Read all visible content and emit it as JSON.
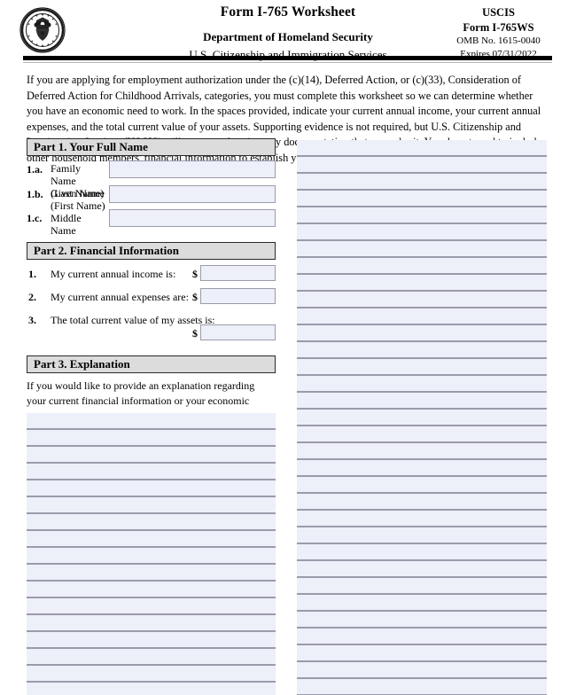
{
  "document": {
    "header": {
      "seal_icon": "dhs-seal-icon",
      "title": "Form I-765 Worksheet",
      "department": "Department of Homeland Security",
      "agency": "U.S. Citizenship and Immigration Services",
      "agency_short": "USCIS",
      "form_number": "Form I-765WS",
      "omb_number": "OMB No. 1615-0040",
      "expires": "Expires 07/31/2022"
    },
    "intro": "If you are applying for employment authorization under the (c)(14), Deferred Action, or (c)(33), Consideration of Deferred Action for Childhood Arrivals, categories, you must complete this worksheet so we can determine whether you have an economic need to work. In the spaces provided, indicate your current annual income, your current annual expenses, and the total current value of your assets. Supporting evidence is not required, but U.S. Citizenship and Immigration Services (USCIS) will accept and review any documentation that you submit.  You do not need to include other household members' financial information to establish your own economic necessity.",
    "part1": {
      "heading": "Part 1.  Your Full Name",
      "items": [
        {
          "number": "1.a.",
          "label_line1": "Family Name",
          "label_line2": "(Last Name)",
          "value": ""
        },
        {
          "number": "1.b.",
          "label_line1": "Given Name",
          "label_line2": "(First Name)",
          "value": ""
        },
        {
          "number": "1.c.",
          "label_line1": "Middle Name",
          "label_line2": "",
          "value": ""
        }
      ]
    },
    "part2": {
      "heading": "Part 2.  Financial Information",
      "currency_symbol": "$",
      "items": [
        {
          "number": "1.",
          "label": "My current annual income is:",
          "value": ""
        },
        {
          "number": "2.",
          "label": "My current annual expenses are:",
          "value": ""
        },
        {
          "number": "3.",
          "label": "The total current value of my assets is:",
          "value": ""
        }
      ]
    },
    "part3": {
      "heading": "Part 3.  Explanation",
      "instruction": "If you would like to provide an explanation regarding your current financial information or your economic need for employment authorization, use the space below.",
      "explanation_text": ""
    },
    "colors": {
      "field_fill": "#edeff9",
      "field_border": "#9b9bab",
      "part_bar_fill": "#dcdcdc",
      "part_bar_border": "#2a2a2a",
      "rule_line": "#9b9baa"
    }
  }
}
